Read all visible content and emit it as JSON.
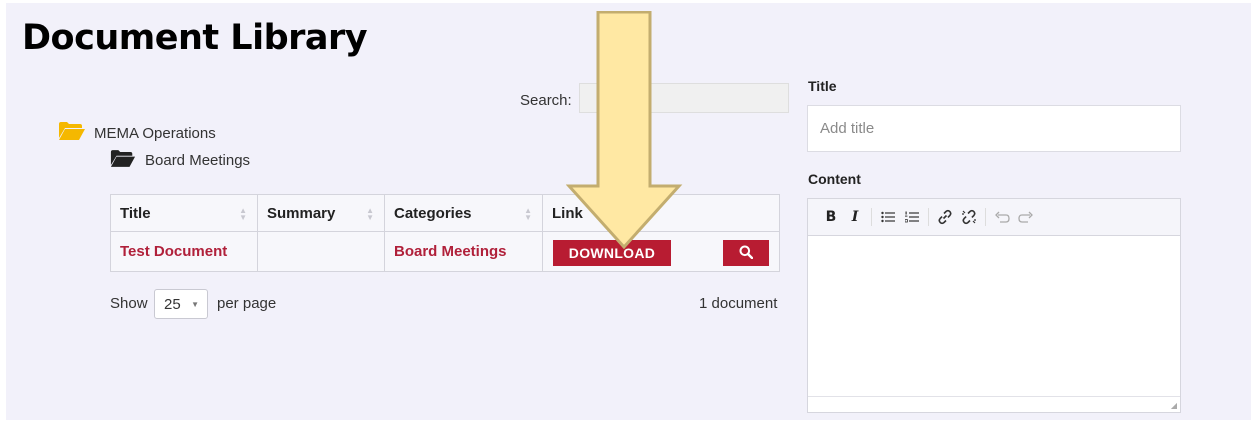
{
  "page": {
    "title": "Document Library"
  },
  "search": {
    "label": "Search:",
    "placeholder": "",
    "value": ""
  },
  "tree": {
    "root": {
      "label": "MEMA Operations",
      "icon": "folder-open-icon",
      "color": "#f5b800"
    },
    "child": {
      "label": "Board Meetings",
      "icon": "folder-open-icon",
      "color": "#222222"
    }
  },
  "table": {
    "headers": {
      "title": "Title",
      "summary": "Summary",
      "categories": "Categories",
      "link": "Link"
    },
    "rows": [
      {
        "title": "Test Document",
        "summary": "",
        "categories": "Board Meetings",
        "download_label": "DOWNLOAD",
        "preview_icon": "search-icon"
      }
    ]
  },
  "pagination": {
    "show_label": "Show",
    "per_page_value": "25",
    "per_page_label": "per page",
    "count": "1 document"
  },
  "editor": {
    "title_label": "Title",
    "title_placeholder": "Add title",
    "content_label": "Content",
    "toolbar": [
      "bold-icon",
      "italic-icon",
      "bullet-list-icon",
      "numbered-list-icon",
      "link-icon",
      "unlink-icon",
      "undo-icon",
      "redo-icon"
    ]
  },
  "colors": {
    "accent": "#b81c32",
    "arrow_fill": "#ffe8a3",
    "arrow_stroke": "#c3ad6f",
    "page_bg": "#f2f1fa"
  }
}
